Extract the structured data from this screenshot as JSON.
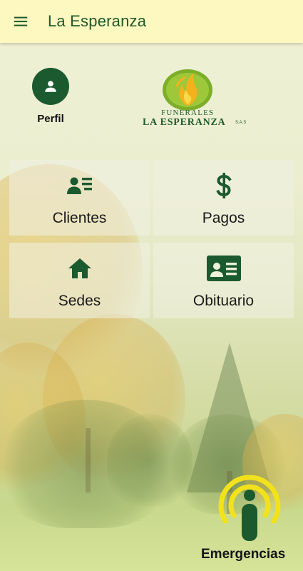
{
  "appbar": {
    "title": "La Esperanza",
    "menu_icon": "menu-icon"
  },
  "profile": {
    "label": "Perfil",
    "icon": "person-icon"
  },
  "logo": {
    "line1": "FUNERALES",
    "line2": "LA ESPERANZA",
    "suffix": "S.A.S"
  },
  "menu": {
    "items": [
      {
        "label": "Clientes",
        "icon": "clients-list-icon"
      },
      {
        "label": "Pagos",
        "icon": "dollar-icon"
      },
      {
        "label": "Sedes",
        "icon": "home-icon"
      },
      {
        "label": "Obituario",
        "icon": "id-card-icon"
      }
    ]
  },
  "emergency": {
    "label": "Emergencias",
    "icon": "emergency-broadcast-icon"
  },
  "colors": {
    "primary": "#1b5a2e",
    "appbar_bg": "#fdf7c0",
    "emergency_accent": "#f2e21c"
  }
}
